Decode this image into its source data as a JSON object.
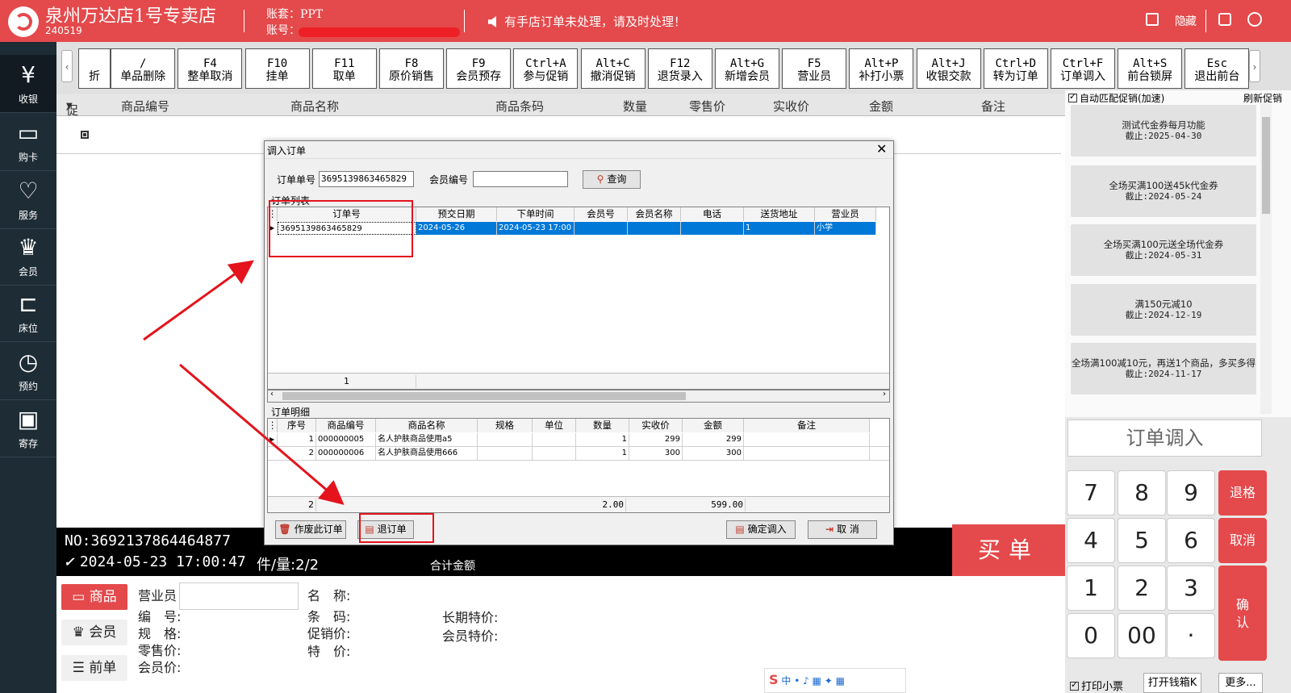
{
  "header": {
    "store_name": "泉州万达店1号专卖店",
    "store_code": "240519",
    "account_set": "账套：PPT",
    "account_no": "账号：",
    "notice": "有手店订单未处理，请及时处理！",
    "hide": "隐",
    "hide2": "藏",
    "accent_color": "#e4494b"
  },
  "sidebar": {
    "items": [
      {
        "label": "收银",
        "icon": "cashier-icon"
      },
      {
        "label": "购卡",
        "icon": "card-icon"
      },
      {
        "label": "服务",
        "icon": "service-icon"
      },
      {
        "label": "会员",
        "icon": "crown-icon"
      },
      {
        "label": "床位",
        "icon": "bed-icon"
      },
      {
        "label": "预约",
        "icon": "calendar-icon"
      },
      {
        "label": "寄存",
        "icon": "storage-icon"
      }
    ]
  },
  "toolbar": {
    "buttons": [
      {
        "key": "",
        "label": "折"
      },
      {
        "key": "/",
        "label": "单品删除"
      },
      {
        "key": "F4",
        "label": "整单取消"
      },
      {
        "key": "F10",
        "label": "挂单"
      },
      {
        "key": "F11",
        "label": "取单"
      },
      {
        "key": "F8",
        "label": "原价销售"
      },
      {
        "key": "F9",
        "label": "会员预存"
      },
      {
        "key": "Ctrl+A",
        "label": "参与促销"
      },
      {
        "key": "Alt+C",
        "label": "撤消促销"
      },
      {
        "key": "F12",
        "label": "退货录入"
      },
      {
        "key": "Alt+G",
        "label": "新增会员"
      },
      {
        "key": "F5",
        "label": "营业员"
      },
      {
        "key": "Alt+P",
        "label": "补打小票"
      },
      {
        "key": "Alt+J",
        "label": "收银交款"
      },
      {
        "key": "Ctrl+D",
        "label": "转为订单"
      },
      {
        "key": "Ctrl+F",
        "label": "订单调入"
      },
      {
        "key": "Alt+S",
        "label": "前台锁屏"
      },
      {
        "key": "Esc",
        "label": "退出前台"
      }
    ]
  },
  "grid": {
    "columns": [
      "促",
      "商品编号",
      "商品名称",
      "商品条码",
      "数量",
      "零售价",
      "实收价",
      "金额",
      "备注"
    ]
  },
  "promos": {
    "auto_match": "自动匹配促销(加速)",
    "refresh": "刷新促销",
    "items": [
      {
        "name": "测试代金券每月功能",
        "deadline": "截止:2025-04-30"
      },
      {
        "name": "全场买满100送45k代金券",
        "deadline": "截止:2024-05-24"
      },
      {
        "name": "全场买满100元送全场代金券",
        "deadline": "截止:2024-05-31"
      },
      {
        "name": "满150元减10",
        "deadline": "截止:2024-12-19"
      },
      {
        "name": "全场满100减10元，再送1个商品，多买多得",
        "deadline": "截止:2024-11-17"
      }
    ]
  },
  "order_import_title": "订单调入",
  "keypad": {
    "keys": [
      "7",
      "8",
      "9",
      "4",
      "5",
      "6",
      "1",
      "2",
      "3",
      "0",
      "00",
      "·"
    ],
    "backspace": "退格",
    "cancel": "取消",
    "confirm": "确认"
  },
  "footer_right": {
    "print_receipt": "打印小票",
    "open_drawer": "打开钱箱K",
    "more": "更多..."
  },
  "status": {
    "no": "NO:3692137864464877",
    "datetime": "2024-05-23 17:00:47",
    "count": "件/量:2/2",
    "total_label": "合计金额",
    "buy": "买单"
  },
  "bottom": {
    "tabs": [
      "商品",
      "会员",
      "前单"
    ],
    "salesman": "营业员",
    "code": "编　号:",
    "spec": "规　格:",
    "retail": "零售价:",
    "member_price": "会员价:",
    "name": "名　称:",
    "barcode": "条　码:",
    "promo_price": "促销价:",
    "special": "特　价:",
    "long_special": "长期特价:",
    "member_special": "会员特价:"
  },
  "ime": {
    "label": "中"
  },
  "dialog": {
    "title": "调入订单",
    "order_no_label": "订单单号",
    "order_no_value": "3695139863465829",
    "member_no_label": "会员编号",
    "member_no_value": "",
    "query": "查询",
    "list_label": "订单列表",
    "list_columns": [
      "订单号",
      "预交日期",
      "下单时间",
      "会员号",
      "会员名称",
      "电话",
      "送货地址",
      "营业员"
    ],
    "list_rows": [
      [
        "3695139863465829",
        "2024-05-26",
        "2024-05-23 17:00",
        "",
        "",
        "",
        "1",
        "小学"
      ]
    ],
    "list_count": "1",
    "detail_label": "订单明细",
    "detail_columns": [
      "序号",
      "商品编号",
      "商品名称",
      "规格",
      "单位",
      "数量",
      "实收价",
      "金额",
      "备注"
    ],
    "detail_rows": [
      [
        "1",
        "000000005",
        "名人护肤商品使用a5",
        "",
        "",
        "1",
        "299",
        "299",
        ""
      ],
      [
        "2",
        "000000006",
        "名人护肤商品使用666",
        "",
        "",
        "1",
        "300",
        "300",
        ""
      ]
    ],
    "detail_count": "2",
    "detail_qty_total": "2.00",
    "detail_amount_total": "599.00",
    "void_order": "作废此订单",
    "return_order": "退订单",
    "confirm_import": "确定调入",
    "cancel": "取 消"
  }
}
